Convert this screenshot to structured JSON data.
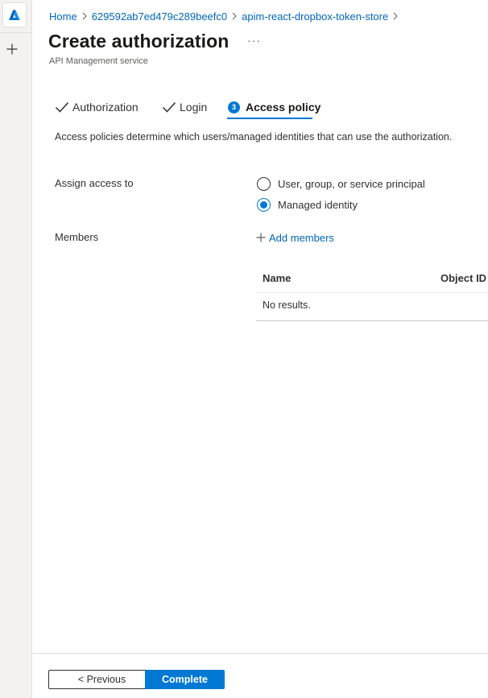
{
  "breadcrumb": {
    "items": [
      "Home",
      "629592ab7ed479c289beefc0",
      "apim-react-dropbox-token-store"
    ]
  },
  "header": {
    "title": "Create authorization",
    "more": "···",
    "subtitle": "API Management service"
  },
  "tabs": [
    {
      "label": "Authorization",
      "state": "completed"
    },
    {
      "label": "Login",
      "state": "completed"
    },
    {
      "label": "Access policy",
      "state": "active",
      "step": "3"
    }
  ],
  "main": {
    "description": "Access policies determine which users/managed identities that can use the authorization.",
    "assign_label": "Assign access to",
    "options": [
      {
        "label": "User, group, or service principal",
        "selected": false
      },
      {
        "label": "Managed identity",
        "selected": true
      }
    ],
    "members_label": "Members",
    "add_members": "Add members",
    "table": {
      "columns": [
        "Name",
        "Object ID"
      ],
      "empty_text": "No results."
    }
  },
  "footer": {
    "previous_label": "< Previous",
    "complete_label": "Complete"
  },
  "colors": {
    "accent": "#0078d4",
    "link": "#0066b8",
    "text": "#323130"
  }
}
